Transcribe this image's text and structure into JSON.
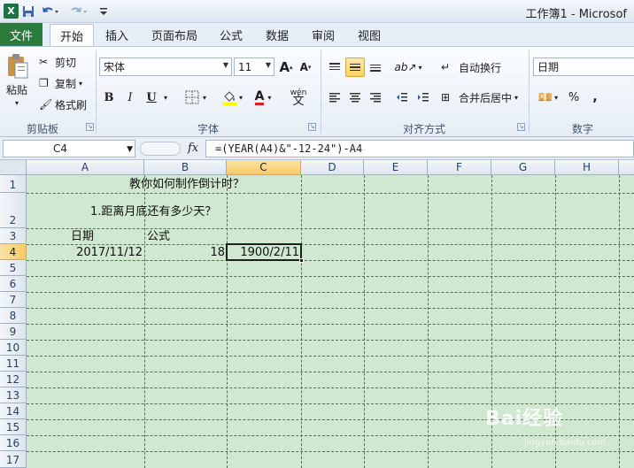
{
  "window": {
    "app_logo": "X",
    "title": "工作簿1 - Microsof"
  },
  "quick_access": {
    "save_icon": "save-icon",
    "undo_icon": "undo-icon",
    "redo_icon": "redo-icon",
    "customize_icon": "customize-icon"
  },
  "tabs": [
    {
      "label": "文件"
    },
    {
      "label": "开始"
    },
    {
      "label": "插入"
    },
    {
      "label": "页面布局"
    },
    {
      "label": "公式"
    },
    {
      "label": "数据"
    },
    {
      "label": "审阅"
    },
    {
      "label": "视图"
    }
  ],
  "ribbon": {
    "clipboard": {
      "label": "剪贴板",
      "paste": "粘贴",
      "cut": "剪切",
      "copy": "复制",
      "format_painter": "格式刷"
    },
    "font": {
      "label": "字体",
      "name": "宋体",
      "size": "11",
      "grow": "A",
      "shrink": "A",
      "bold": "B",
      "italic": "I",
      "underline": "U",
      "wen": "wén",
      "wen_char": "文"
    },
    "alignment": {
      "label": "对齐方式",
      "wrap": "自动换行",
      "merge": "合并后居中"
    },
    "number": {
      "label": "数字",
      "format": "日期",
      "percent": "%",
      "comma": ","
    }
  },
  "formula_bar": {
    "name_box": "C4",
    "fx": "fx",
    "formula": "=(YEAR(A4)&\"-12-24\")-A4"
  },
  "sheet": {
    "columns": [
      "A",
      "B",
      "C",
      "D",
      "E",
      "F",
      "G",
      "H"
    ],
    "selected_column": "C",
    "rows": [
      "1",
      "2",
      "3",
      "4",
      "5",
      "6",
      "7",
      "8",
      "9",
      "10",
      "11",
      "12",
      "13",
      "14",
      "15",
      "16",
      "17"
    ],
    "selected_row": "4",
    "cells": {
      "B1": "教你如何制作倒计时？",
      "A2": "1.距离月底还有多少天？",
      "A3": "日期",
      "B3": "公式",
      "A4": "2017/11/12",
      "B4": "18",
      "C4": "1900/2/11"
    }
  },
  "watermark": {
    "text": "Bai经验",
    "sub": "jingyan.baidu.com"
  }
}
